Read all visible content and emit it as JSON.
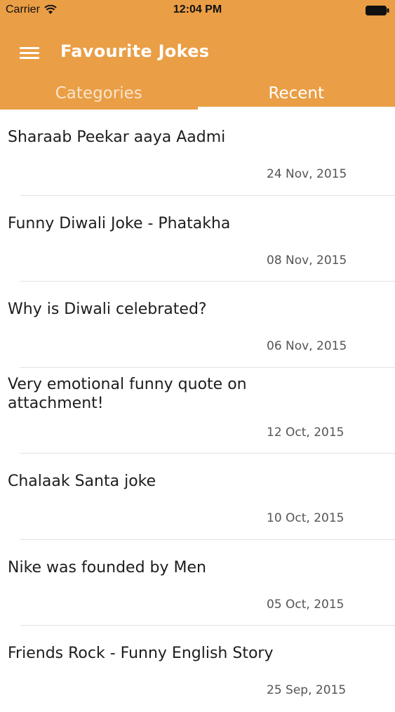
{
  "status_bar": {
    "carrier": "Carrier",
    "time": "12:04 PM"
  },
  "app_bar": {
    "title": "Favourite Jokes",
    "background_color": "#EA9E45"
  },
  "tabs": [
    {
      "label": "Categories",
      "selected": false
    },
    {
      "label": "Recent",
      "selected": true
    }
  ],
  "jokes": [
    {
      "title": "Sharaab Peekar aaya Aadmi",
      "date": "24 Nov, 2015"
    },
    {
      "title": "Funny Diwali Joke - Phatakha",
      "date": "08 Nov, 2015"
    },
    {
      "title": "Why is Diwali celebrated?",
      "date": "06 Nov, 2015"
    },
    {
      "title": "Very emotional funny quote on attachment!",
      "date": "12 Oct, 2015"
    },
    {
      "title": "Chalaak Santa joke",
      "date": "10 Oct, 2015"
    },
    {
      "title": "Nike was founded by Men",
      "date": "05 Oct, 2015"
    },
    {
      "title": "Friends Rock - Funny English Story",
      "date": "25 Sep, 2015"
    }
  ]
}
